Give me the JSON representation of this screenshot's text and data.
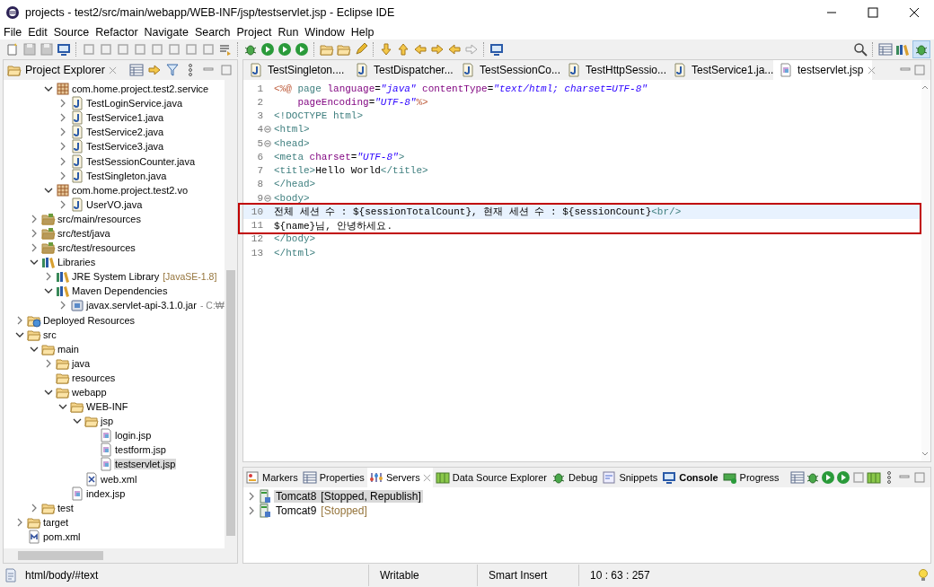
{
  "window": {
    "title": "projects - test2/src/main/webapp/WEB-INF/jsp/testservlet.jsp - Eclipse IDE"
  },
  "menu": [
    "File",
    "Edit",
    "Source",
    "Refactor",
    "Navigate",
    "Search",
    "Project",
    "Run",
    "Window",
    "Help"
  ],
  "project_explorer": {
    "title": "Project Explorer",
    "items": [
      {
        "children": [
          {
            "children": [
              {
                "label": "com.home.project.test2.service",
                "kind": "package",
                "expanded": true,
                "selected": false,
                "children": [
                  {
                    "label": "TestLoginService.java",
                    "kind": "java",
                    "expanded": false,
                    "selected": false
                  },
                  {
                    "label": "TestService1.java",
                    "kind": "java",
                    "expanded": false,
                    "selected": false
                  },
                  {
                    "label": "TestService2.java",
                    "kind": "java",
                    "expanded": false,
                    "selected": false
                  },
                  {
                    "label": "TestService3.java",
                    "kind": "java",
                    "expanded": false,
                    "selected": false
                  },
                  {
                    "label": "TestSessionCounter.java",
                    "kind": "java",
                    "expanded": false,
                    "selected": false
                  },
                  {
                    "label": "TestSingleton.java",
                    "kind": "java",
                    "expanded": false,
                    "selected": false
                  }
                ]
              },
              {
                "label": "com.home.project.test2.vo",
                "kind": "package",
                "expanded": true,
                "selected": false,
                "children": [
                  {
                    "label": "UserVO.java",
                    "kind": "java",
                    "expanded": false,
                    "selected": false
                  }
                ]
              }
            ]
          },
          {
            "label": "src/main/resources",
            "kind": "srcfolder",
            "expanded": false,
            "selected": false
          },
          {
            "label": "src/test/java",
            "kind": "srcfolder",
            "expanded": false,
            "selected": false
          },
          {
            "label": "src/test/resources",
            "kind": "srcfolder",
            "expanded": false,
            "selected": false
          },
          {
            "label": "Libraries",
            "kind": "library",
            "expanded": true,
            "selected": false,
            "children": [
              {
                "label": "JRE System Library",
                "kind": "library",
                "expanded": false,
                "selected": false,
                "suffix": {
                  "text": "[JavaSE-1.8]",
                  "kind": "version"
                }
              },
              {
                "label": "Maven Dependencies",
                "kind": "library",
                "expanded": true,
                "selected": false,
                "children": [
                  {
                    "label": "javax.servlet-api-3.1.0.jar",
                    "kind": "jar",
                    "expanded": false,
                    "selected": false,
                    "suffix": {
                      "text": "- C:₩",
                      "kind": "path"
                    }
                  }
                ]
              }
            ]
          }
        ]
      },
      {
        "label": "Deployed Resources",
        "kind": "deployed",
        "expanded": false,
        "selected": false
      },
      {
        "label": "src",
        "kind": "folder",
        "expanded": true,
        "selected": false,
        "children": [
          {
            "label": "main",
            "kind": "folder",
            "expanded": true,
            "selected": false,
            "children": [
              {
                "label": "java",
                "kind": "folder",
                "expanded": false,
                "selected": false
              },
              {
                "label": "resources",
                "kind": "folder",
                "selected": false
              },
              {
                "label": "webapp",
                "kind": "folder",
                "expanded": true,
                "selected": false,
                "children": [
                  {
                    "label": "WEB-INF",
                    "kind": "folder",
                    "expanded": true,
                    "selected": false,
                    "children": [
                      {
                        "label": "jsp",
                        "kind": "folder",
                        "expanded": true,
                        "selected": false,
                        "children": [
                          {
                            "label": "login.jsp",
                            "kind": "jsp",
                            "selected": false
                          },
                          {
                            "label": "testform.jsp",
                            "kind": "jsp",
                            "selected": false
                          },
                          {
                            "label": "testservlet.jsp",
                            "kind": "jsp",
                            "selected": true
                          }
                        ]
                      },
                      {
                        "label": "web.xml",
                        "kind": "xml",
                        "selected": false
                      }
                    ]
                  },
                  {
                    "label": "index.jsp",
                    "kind": "jsp",
                    "selected": false
                  }
                ]
              }
            ]
          },
          {
            "label": "test",
            "kind": "folder",
            "expanded": false,
            "selected": false
          }
        ]
      },
      {
        "label": "target",
        "kind": "folder",
        "expanded": false,
        "selected": false
      },
      {
        "label": "pom.xml",
        "kind": "pom",
        "selected": false
      }
    ]
  },
  "editor": {
    "tabs": [
      {
        "label": "TestSingleton....",
        "kind": "java",
        "selected": false
      },
      {
        "label": "TestDispatcher...",
        "kind": "java",
        "selected": false
      },
      {
        "label": "TestSessionCo...",
        "kind": "java",
        "selected": false
      },
      {
        "label": "TestHttpSessio...",
        "kind": "java",
        "selected": false
      },
      {
        "label": "TestService1.ja...",
        "kind": "java",
        "selected": false
      },
      {
        "label": "testservlet.jsp",
        "kind": "jsp",
        "selected": true
      }
    ],
    "lines": [
      {
        "number": "1",
        "fold": false,
        "current": false,
        "boxed": false,
        "tokens": [
          {
            "kind": "directive",
            "text": "<%@"
          },
          {
            "kind": "tag",
            "text": " page"
          },
          {
            "kind": "attr",
            "text": " language"
          },
          {
            "kind": "plain",
            "text": "="
          },
          {
            "kind": "string",
            "text": "\"java\""
          },
          {
            "kind": "attr",
            "text": " contentType"
          },
          {
            "kind": "plain",
            "text": "="
          },
          {
            "kind": "string",
            "text": "\"text/html; charset=UTF-8\""
          }
        ]
      },
      {
        "number": "2",
        "fold": false,
        "current": false,
        "boxed": false,
        "tokens": [
          {
            "kind": "attr",
            "text": "    pageEncoding"
          },
          {
            "kind": "plain",
            "text": "="
          },
          {
            "kind": "string",
            "text": "\"UTF-8\""
          },
          {
            "kind": "directive",
            "text": "%>"
          }
        ]
      },
      {
        "number": "3",
        "fold": false,
        "current": false,
        "boxed": false,
        "tokens": [
          {
            "kind": "tag",
            "text": "<!DOCTYPE html>"
          }
        ]
      },
      {
        "number": "4",
        "fold": true,
        "current": false,
        "boxed": false,
        "tokens": [
          {
            "kind": "tag",
            "text": "<html>"
          }
        ]
      },
      {
        "number": "5",
        "fold": true,
        "current": false,
        "boxed": false,
        "tokens": [
          {
            "kind": "tag",
            "text": "<head>"
          }
        ]
      },
      {
        "number": "6",
        "fold": false,
        "current": false,
        "boxed": false,
        "tokens": [
          {
            "kind": "tag",
            "text": "<meta"
          },
          {
            "kind": "attr",
            "text": " charset"
          },
          {
            "kind": "plain",
            "text": "="
          },
          {
            "kind": "string",
            "text": "\"UTF-8\""
          },
          {
            "kind": "tag",
            "text": ">"
          }
        ]
      },
      {
        "number": "7",
        "fold": false,
        "current": false,
        "boxed": false,
        "tokens": [
          {
            "kind": "tag",
            "text": "<title>"
          },
          {
            "kind": "plain",
            "text": "Hello World"
          },
          {
            "kind": "tag",
            "text": "</title>"
          }
        ]
      },
      {
        "number": "8",
        "fold": false,
        "current": false,
        "boxed": false,
        "tokens": [
          {
            "kind": "tag",
            "text": "</head>"
          }
        ]
      },
      {
        "number": "9",
        "fold": true,
        "current": false,
        "boxed": false,
        "tokens": [
          {
            "kind": "tag",
            "text": "<body>"
          }
        ]
      },
      {
        "number": "10",
        "fold": false,
        "current": true,
        "boxed": true,
        "tokens": [
          {
            "kind": "plain",
            "text": "전체 세션 수 : ${sessionTotalCount}, 현재 세션 수 : ${sessionCount}"
          },
          {
            "kind": "tag",
            "text": "<br/>"
          }
        ]
      },
      {
        "number": "11",
        "fold": false,
        "current": false,
        "boxed": true,
        "tokens": [
          {
            "kind": "plain",
            "text": "${name}님, 안녕하세요."
          }
        ]
      },
      {
        "number": "12",
        "fold": false,
        "current": false,
        "boxed": false,
        "tokens": [
          {
            "kind": "tag",
            "text": "</body>"
          }
        ]
      },
      {
        "number": "13",
        "fold": false,
        "current": false,
        "boxed": false,
        "tokens": [
          {
            "kind": "tag",
            "text": "</html>"
          }
        ]
      }
    ]
  },
  "bottom_panel": {
    "tabs": [
      {
        "label": "Markers",
        "kind": "markers",
        "selected": false,
        "bold": false
      },
      {
        "label": "Properties",
        "kind": "properties",
        "selected": false,
        "bold": false
      },
      {
        "label": "Servers",
        "kind": "servers",
        "selected": true,
        "bold": false
      },
      {
        "label": "Data Source Explorer",
        "kind": "datasource",
        "selected": false,
        "bold": false
      },
      {
        "label": "Debug",
        "kind": "debug",
        "selected": false,
        "bold": false
      },
      {
        "label": "Snippets",
        "kind": "snippets",
        "selected": false,
        "bold": false
      },
      {
        "label": "Console",
        "kind": "console",
        "selected": false,
        "bold": true
      },
      {
        "label": "Progress",
        "kind": "progress",
        "selected": false,
        "bold": false
      }
    ],
    "servers": [
      {
        "name": "Tomcat8",
        "status": "[Stopped, Republish]",
        "selected": true
      },
      {
        "name": "Tomcat9",
        "status": "[Stopped]",
        "selected": false
      }
    ]
  },
  "status_bar": {
    "path": "html/body/#text",
    "mode": "Writable",
    "insert": "Smart Insert",
    "position": "10 : 63 : 257"
  }
}
